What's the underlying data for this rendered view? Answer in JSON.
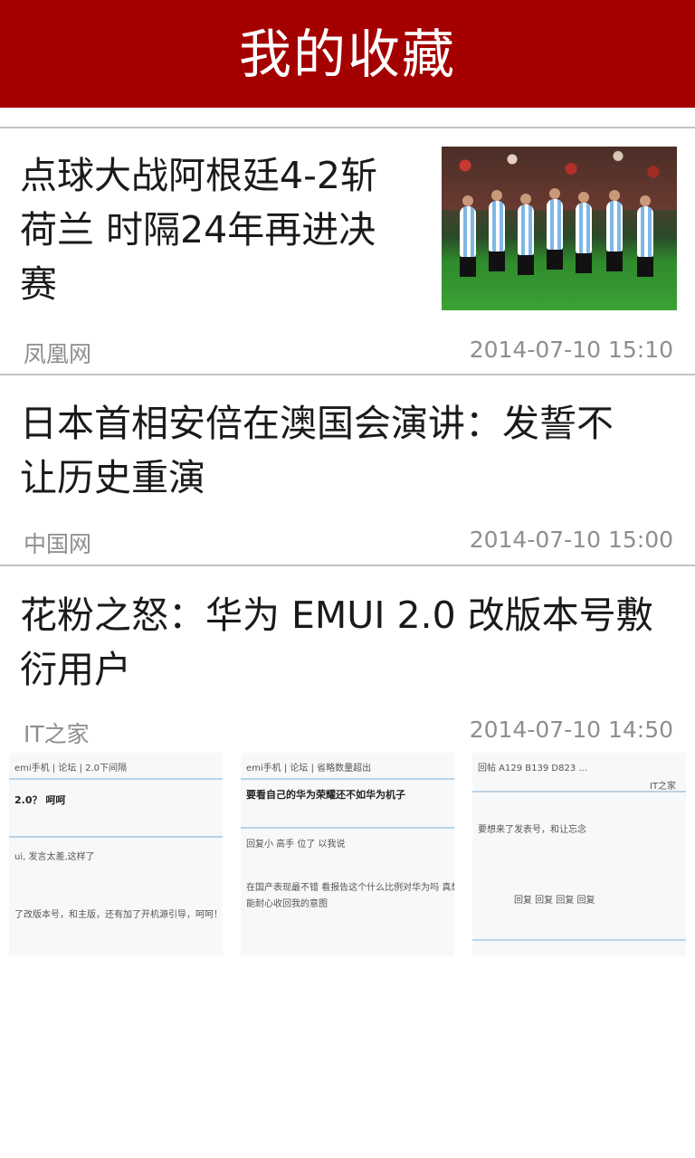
{
  "header": {
    "title": "我的收藏"
  },
  "articles": [
    {
      "title_lines": [
        "点球大战阿根廷4-2斩",
        "荷兰 时隔24年再进决",
        "赛"
      ],
      "source": "凤凰网",
      "time": "2014-07-10 15:10"
    },
    {
      "title_lines": [
        "日本首相安倍在澳国会演讲：发誓不",
        "让历史重演"
      ],
      "source": "中国网",
      "time": "2014-07-10 15:00"
    },
    {
      "title_lines": [
        "花粉之怒：华为 EMUI 2.0 改版本号敷",
        "衍用户"
      ],
      "source": "IT之家",
      "time": "2014-07-10 14:50"
    }
  ],
  "thumbnails": [
    {
      "lines": [
        "emi手机 | 论坛 | 2.0下间隔",
        "2.0？ 呵呵",
        "ui, 发言太差,这样了",
        "了改版本号，和主版，还有加了开机源引导，呵呵！"
      ]
    },
    {
      "lines": [
        "emi手机 | 论坛 | 省略数量超出",
        "要看自己的华为荣耀还不如华为机子",
        "回复小 高手 位了 以我说",
        "在国产表现最不错 看报告这个什么比例对华为吗 真想很想",
        "能耐心收回我的意图"
      ]
    },
    {
      "lines": [
        "回帖 A129 B139 D823 ...",
        "IT之家",
        "要想来了发表号，和让忘念",
        "回复 回复 回复 回复"
      ]
    }
  ]
}
